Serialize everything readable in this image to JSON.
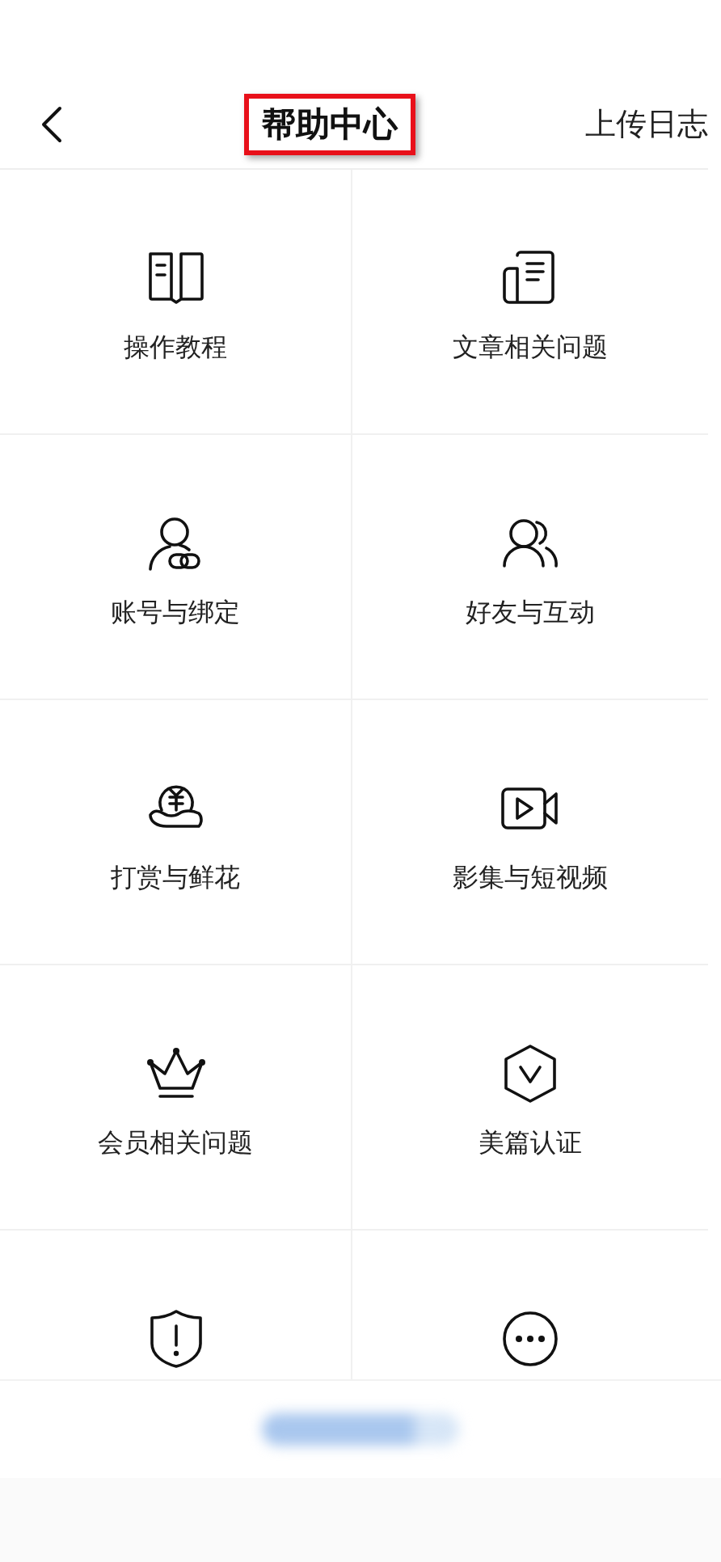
{
  "header": {
    "title": "帮助中心",
    "title_highlighted": true,
    "action": "上传日志"
  },
  "items": [
    {
      "kind": "book",
      "label": "操作教程"
    },
    {
      "kind": "article",
      "label": "文章相关问题"
    },
    {
      "kind": "account",
      "label": "账号与绑定"
    },
    {
      "kind": "friends",
      "label": "好友与互动"
    },
    {
      "kind": "reward",
      "label": "打赏与鲜花"
    },
    {
      "kind": "video",
      "label": "影集与短视频"
    },
    {
      "kind": "crown",
      "label": "会员相关问题"
    },
    {
      "kind": "badge",
      "label": "美篇认证"
    },
    {
      "kind": "shield"
    },
    {
      "kind": "more"
    }
  ]
}
